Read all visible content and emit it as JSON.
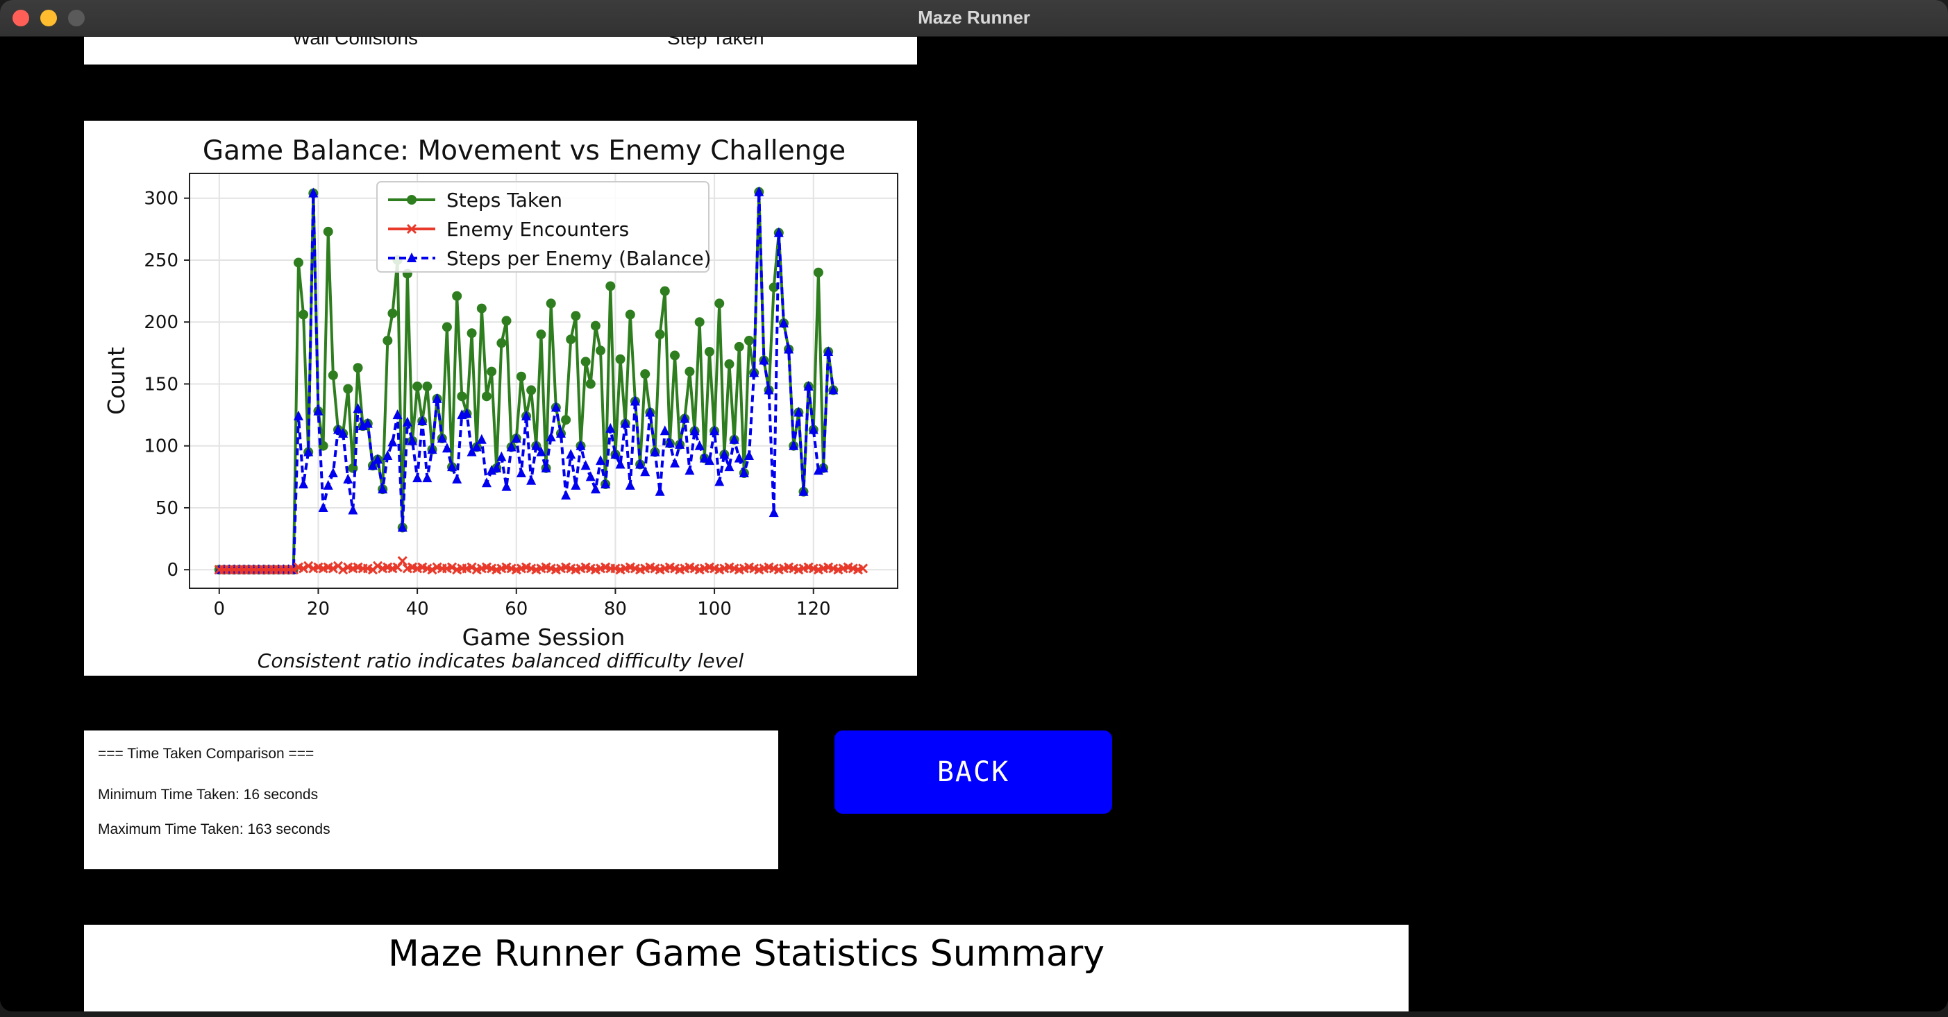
{
  "window": {
    "title": "Maze Runner"
  },
  "top_panel": {
    "left_label": "Wall Collisions",
    "right_label": "Step Taken"
  },
  "chart_data": {
    "type": "line",
    "title": "Game Balance: Movement vs Enemy Challenge",
    "xlabel": "Game Session",
    "ylabel": "Count",
    "caption": "Consistent ratio indicates balanced difficulty level",
    "xlim": [
      -6,
      137
    ],
    "ylim": [
      -15,
      320
    ],
    "xticks": [
      0,
      20,
      40,
      60,
      80,
      100,
      120
    ],
    "yticks": [
      0,
      50,
      100,
      150,
      200,
      250,
      300
    ],
    "grid": true,
    "legend_position": "upper center",
    "x_start": 0,
    "series": [
      {
        "name": "Steps Taken",
        "color": "#2e7d1e",
        "marker": "circle",
        "linestyle": "solid",
        "values": [
          0,
          0,
          0,
          0,
          0,
          0,
          0,
          0,
          0,
          0,
          0,
          0,
          0,
          0,
          0,
          0,
          248,
          206,
          95,
          304,
          128,
          100,
          273,
          157,
          113,
          110,
          146,
          82,
          163,
          116,
          118,
          84,
          89,
          65,
          185,
          207,
          250,
          34,
          239,
          104,
          148,
          120,
          148,
          97,
          138,
          106,
          196,
          83,
          221,
          140,
          126,
          191,
          99,
          211,
          140,
          160,
          82,
          183,
          201,
          99,
          106,
          156,
          124,
          145,
          100,
          190,
          82,
          215,
          131,
          110,
          121,
          186,
          205,
          100,
          168,
          150,
          197,
          177,
          69,
          229,
          93,
          170,
          118,
          206,
          136,
          85,
          158,
          127,
          95,
          190,
          225,
          102,
          173,
          101,
          122,
          160,
          112,
          200,
          90,
          176,
          112,
          215,
          93,
          166,
          105,
          180,
          78,
          185,
          159,
          305,
          169,
          145,
          228,
          272,
          199,
          178,
          100,
          127,
          63,
          148,
          113,
          240,
          82,
          176,
          145
        ],
        "values_note": "estimated"
      },
      {
        "name": "Enemy Encounters",
        "color": "#e8392a",
        "marker": "x",
        "linestyle": "solid",
        "values": [
          0,
          0,
          0,
          0,
          0,
          0,
          0,
          0,
          0,
          0,
          0,
          0,
          0,
          0,
          0,
          0,
          2,
          1,
          3,
          1,
          2,
          1,
          2,
          1,
          3,
          0,
          2,
          1,
          2,
          1,
          1,
          0,
          3,
          1,
          2,
          1,
          2,
          7,
          1,
          2,
          1,
          2,
          1,
          0,
          2,
          1,
          1,
          2,
          0,
          1,
          1,
          2,
          0,
          1,
          2,
          1,
          0,
          1,
          2,
          1,
          0,
          1,
          2,
          1,
          0,
          1,
          2,
          1,
          0,
          1,
          2,
          1,
          0,
          1,
          2,
          1,
          0,
          1,
          2,
          1,
          1,
          0,
          1,
          2,
          1,
          0,
          1,
          2,
          1,
          0,
          1,
          2,
          1,
          0,
          1,
          2,
          1,
          0,
          1,
          2,
          1,
          0,
          1,
          2,
          1,
          0,
          1,
          2,
          1,
          0,
          1,
          2,
          1,
          0,
          1,
          2,
          1,
          0,
          1,
          2,
          1,
          0,
          1,
          2,
          1,
          0,
          1,
          2,
          1,
          0,
          1
        ]
      },
      {
        "name": "Steps per Enemy (Balance)",
        "color": "#0000ee",
        "marker": "triangle",
        "linestyle": "dashed",
        "values": [
          0,
          0,
          0,
          0,
          0,
          0,
          0,
          0,
          0,
          0,
          0,
          0,
          0,
          0,
          0,
          0,
          124,
          69,
          95,
          304,
          128,
          50,
          68,
          78,
          113,
          110,
          73,
          48,
          130,
          116,
          118,
          84,
          89,
          65,
          92,
          103,
          125,
          34,
          119,
          104,
          74,
          120,
          74,
          97,
          138,
          106,
          98,
          83,
          73,
          125,
          126,
          95,
          99,
          105,
          70,
          80,
          82,
          91,
          67,
          99,
          106,
          78,
          124,
          72,
          100,
          95,
          82,
          107,
          131,
          110,
          60,
          93,
          68,
          100,
          84,
          75,
          65,
          88,
          69,
          114,
          93,
          85,
          118,
          68,
          136,
          85,
          79,
          127,
          95,
          63,
          112,
          102,
          86,
          101,
          122,
          80,
          112,
          100,
          90,
          88,
          112,
          71,
          93,
          83,
          105,
          90,
          78,
          92,
          159,
          305,
          169,
          145,
          46,
          272,
          199,
          178,
          100,
          127,
          63,
          148,
          113,
          80,
          82,
          176,
          145
        ],
        "values_note": "estimated"
      }
    ]
  },
  "time_panel": {
    "heading": "=== Time Taken Comparison ===",
    "min_line": "Minimum Time Taken: 16 seconds",
    "max_line": "Maximum Time Taken: 163 seconds"
  },
  "back_button": {
    "label": "BACK",
    "color": "#0000ff"
  },
  "summary": {
    "title": "Maze Runner Game Statistics Summary"
  }
}
